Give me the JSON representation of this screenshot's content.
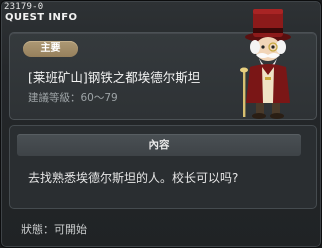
{
  "window": {
    "quest_id": "23179-0",
    "title": "QUEST INFO"
  },
  "quest": {
    "badge": "主要",
    "name": "[莱班矿山]钢铁之都埃德尔斯坦",
    "level_label": "建議等級：60～79"
  },
  "content": {
    "header": "內容",
    "text": "去找熟悉埃德尔斯坦的人。校长可以吗?"
  },
  "status": "狀態：可開始",
  "colors": {
    "badge": "#a38e69",
    "panel": "#2e3235",
    "window_bg": "#24272a",
    "npc_hat": "#8c1a1a"
  },
  "icons": [
    "close-icon",
    "npc-portrait"
  ]
}
